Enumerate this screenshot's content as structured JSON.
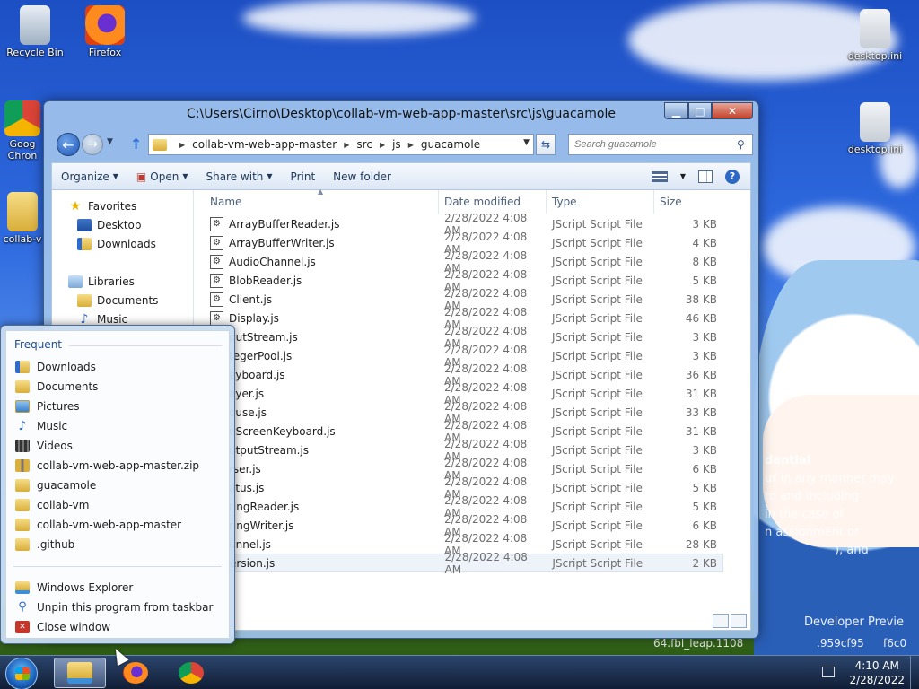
{
  "desktop": {
    "icons": [
      {
        "label": "Recycle Bin"
      },
      {
        "label": "Firefox"
      },
      {
        "label": "Goog Chron"
      },
      {
        "label": "collab-v"
      },
      {
        "label": "desktop.ini"
      },
      {
        "label": "desktop.ini"
      }
    ],
    "wallpaper_text": [
      "dential",
      "ur in any manner may",
      "to and including",
      "in the case of",
      "n assignment or",
      "), and",
      "Developer Previe",
      "64.fbl_leap.1108",
      ".959cf95",
      "f6c0"
    ]
  },
  "explorer": {
    "title": "C:\\Users\\Cirno\\Desktop\\collab-vm-web-app-master\\src\\js\\guacamole",
    "window_buttons": {
      "minimize": "▁",
      "maximize": "□",
      "close": "✕"
    },
    "breadcrumb": [
      "collab-vm-web-app-master",
      "src",
      "js",
      "guacamole"
    ],
    "search_placeholder": "Search guacamole",
    "toolbar": {
      "organize": "Organize",
      "open": "Open",
      "share_with": "Share with",
      "print": "Print",
      "new_folder": "New folder"
    },
    "nav_pane": {
      "favorites": "Favorites",
      "desktop": "Desktop",
      "downloads": "Downloads",
      "libraries": "Libraries",
      "documents": "Documents",
      "music": "Music"
    },
    "columns": {
      "name": "Name",
      "date": "Date modified",
      "type": "Type",
      "size": "Size"
    },
    "files": [
      {
        "name": "ArrayBufferReader.js",
        "date": "2/28/2022 4:08 AM",
        "type": "JScript Script File",
        "size": "3 KB"
      },
      {
        "name": "ArrayBufferWriter.js",
        "date": "2/28/2022 4:08 AM",
        "type": "JScript Script File",
        "size": "4 KB"
      },
      {
        "name": "AudioChannel.js",
        "date": "2/28/2022 4:08 AM",
        "type": "JScript Script File",
        "size": "8 KB"
      },
      {
        "name": "BlobReader.js",
        "date": "2/28/2022 4:08 AM",
        "type": "JScript Script File",
        "size": "5 KB"
      },
      {
        "name": "Client.js",
        "date": "2/28/2022 4:08 AM",
        "type": "JScript Script File",
        "size": "38 KB"
      },
      {
        "name": "Display.js",
        "date": "2/28/2022 4:08 AM",
        "type": "JScript Script File",
        "size": "46 KB"
      },
      {
        "name": "putStream.js",
        "date": "2/28/2022 4:08 AM",
        "type": "JScript Script File",
        "size": "3 KB"
      },
      {
        "name": "tegerPool.js",
        "date": "2/28/2022 4:08 AM",
        "type": "JScript Script File",
        "size": "3 KB"
      },
      {
        "name": "eyboard.js",
        "date": "2/28/2022 4:08 AM",
        "type": "JScript Script File",
        "size": "36 KB"
      },
      {
        "name": "ayer.js",
        "date": "2/28/2022 4:08 AM",
        "type": "JScript Script File",
        "size": "31 KB"
      },
      {
        "name": "ouse.js",
        "date": "2/28/2022 4:08 AM",
        "type": "JScript Script File",
        "size": "33 KB"
      },
      {
        "name": "nScreenKeyboard.js",
        "date": "2/28/2022 4:08 AM",
        "type": "JScript Script File",
        "size": "31 KB"
      },
      {
        "name": "utputStream.js",
        "date": "2/28/2022 4:08 AM",
        "type": "JScript Script File",
        "size": "3 KB"
      },
      {
        "name": "rser.js",
        "date": "2/28/2022 4:08 AM",
        "type": "JScript Script File",
        "size": "6 KB"
      },
      {
        "name": "atus.js",
        "date": "2/28/2022 4:08 AM",
        "type": "JScript Script File",
        "size": "5 KB"
      },
      {
        "name": "ringReader.js",
        "date": "2/28/2022 4:08 AM",
        "type": "JScript Script File",
        "size": "5 KB"
      },
      {
        "name": "ringWriter.js",
        "date": "2/28/2022 4:08 AM",
        "type": "JScript Script File",
        "size": "6 KB"
      },
      {
        "name": "unnel.js",
        "date": "2/28/2022 4:08 AM",
        "type": "JScript Script File",
        "size": "28 KB"
      },
      {
        "name": "ersion.js",
        "date": "2/28/2022 4:08 AM",
        "type": "JScript Script File",
        "size": "2 KB"
      }
    ]
  },
  "jumplist": {
    "header": "Frequent",
    "items": [
      {
        "label": "Downloads",
        "icon": "downloads-icon"
      },
      {
        "label": "Documents",
        "icon": "documents-icon"
      },
      {
        "label": "Pictures",
        "icon": "pictures-icon"
      },
      {
        "label": "Music",
        "icon": "music-icon"
      },
      {
        "label": "Videos",
        "icon": "videos-icon"
      },
      {
        "label": "collab-vm-web-app-master.zip",
        "icon": "zip-icon"
      },
      {
        "label": "guacamole",
        "icon": "folder-icon"
      },
      {
        "label": "collab-vm",
        "icon": "folder-icon"
      },
      {
        "label": "collab-vm-web-app-master",
        "icon": "folder-icon"
      },
      {
        "label": ".github",
        "icon": "folder-icon"
      }
    ],
    "tasks": [
      {
        "label": "Windows Explorer"
      },
      {
        "label": "Unpin this program from taskbar"
      },
      {
        "label": "Close window"
      }
    ]
  },
  "taskbar": {
    "time": "4:10 AM",
    "date": "2/28/2022"
  },
  "colors": {
    "accent": "#1e4d96",
    "selection": "#eef3f9",
    "close_button": "#c2432b"
  }
}
